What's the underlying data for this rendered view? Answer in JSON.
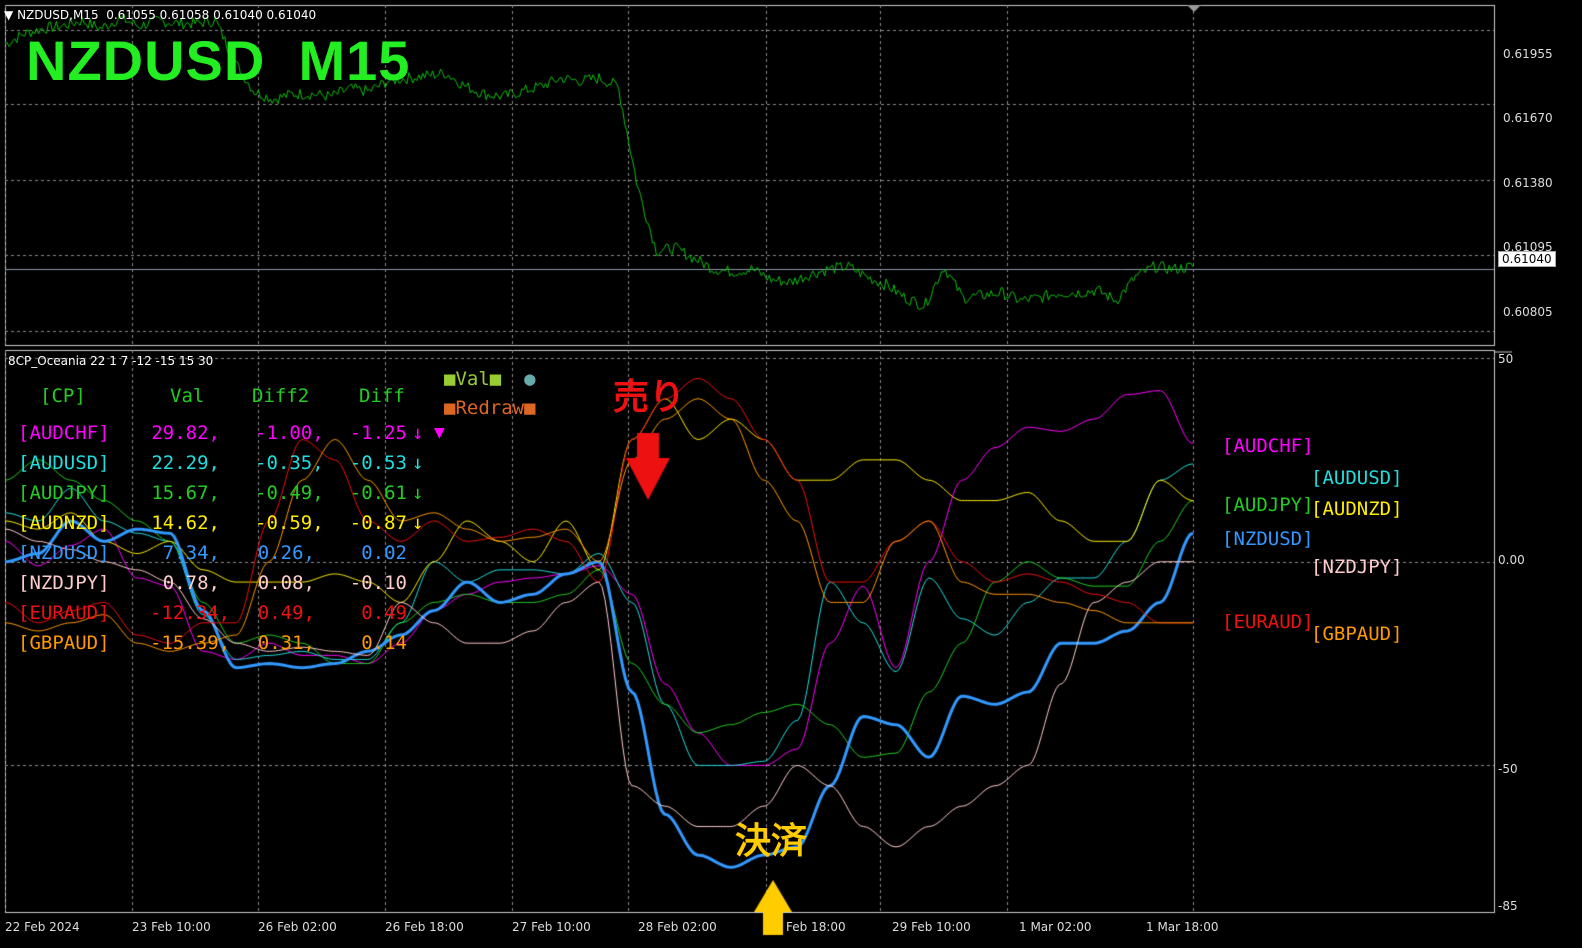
{
  "header": {
    "symbol_text": "NZDUSD,M15  0.61055 0.61058 0.61040 0.61040",
    "big_title": "NZDUSD  M15",
    "indicator_text": "8CP_Oceania 22 1 7 -12 -15 15 30"
  },
  "current_price_label": "0.61040",
  "price_axis": [
    "0.61955",
    "0.61670",
    "0.61380",
    "0.61095",
    "0.60805"
  ],
  "indicator_axis": [
    "50",
    "0.00",
    "-50",
    "-85"
  ],
  "time_axis": [
    "22 Feb 2024",
    "23 Feb 10:00",
    "26 Feb 02:00",
    "26 Feb 18:00",
    "27 Feb 10:00",
    "28 Feb 02:00",
    "Feb 18:00",
    "29 Feb 10:00",
    "1 Mar 02:00",
    "1 Mar 18:00"
  ],
  "legend": {
    "val": "Val",
    "redraw": "Redraw"
  },
  "table": {
    "headers": {
      "cp": "[CP]",
      "val": "Val",
      "diff2": "Diff2",
      "diff": "Diff"
    },
    "rows": [
      {
        "pair": "[AUDCHF]",
        "val": "29.82,",
        "diff2": "-1.00,",
        "diff": "-1.25",
        "arrow": "↓"
      },
      {
        "pair": "[AUDUSD]",
        "val": "22.29,",
        "diff2": "-0.35,",
        "diff": "-0.53",
        "arrow": "↓"
      },
      {
        "pair": "[AUDJPY]",
        "val": "15.67,",
        "diff2": "-0.49,",
        "diff": "-0.61",
        "arrow": "↓"
      },
      {
        "pair": "[AUDNZD]",
        "val": "14.62,",
        "diff2": "-0.59,",
        "diff": "-0.87",
        "arrow": "↓"
      },
      {
        "pair": "[NZDUSD]",
        "val": "7.34,",
        "diff2": "0.26,",
        "diff": "0.02",
        "arrow": ""
      },
      {
        "pair": "[NZDJPY]",
        "val": "0.78,",
        "diff2": "0.08,",
        "diff": "-0.10",
        "arrow": ""
      },
      {
        "pair": "[EURAUD]",
        "val": "-12.34,",
        "diff2": "0.49,",
        "diff": "0.49",
        "arrow": ""
      },
      {
        "pair": "[GBPAUD]",
        "val": "-15.39,",
        "diff2": "0.31,",
        "diff": "0.14",
        "arrow": ""
      }
    ]
  },
  "annotations": {
    "sell": "売り",
    "settle": "決済"
  },
  "colors": {
    "AUDCHF": "#ff00ff",
    "AUDUSD": "#22dddd",
    "AUDJPY": "#22cc22",
    "AUDNZD": "#ffee00",
    "NZDUSD": "#3399ff",
    "NZDJPY": "#ffcccc",
    "EURAUD": "#ee1111",
    "GBPAUD": "#ff9900",
    "price_line": "#11bb11",
    "sell_arrow": "#ee1111",
    "settle_arrow": "#ffcc00"
  },
  "chart_data": [
    {
      "type": "line",
      "series": [
        {
          "name": "NZDUSD",
          "values": [
            0.619,
            0.6194,
            0.6196,
            0.6197,
            0.6199,
            0.6196,
            0.62,
            0.6197,
            0.6199,
            0.6198,
            0.6198,
            0.6199,
            0.6183,
            0.6172,
            0.6169,
            0.6171,
            0.6171,
            0.617,
            0.6173,
            0.6172,
            0.6176,
            0.6177,
            0.6178,
            0.6179,
            0.6174,
            0.6171,
            0.617,
            0.6172,
            0.6174,
            0.6177,
            0.6176,
            0.6177,
            0.6174,
            0.6136,
            0.6111,
            0.6112,
            0.6108,
            0.6104,
            0.6103,
            0.6104,
            0.61,
            0.6099,
            0.6102,
            0.6104,
            0.6105,
            0.6101,
            0.6098,
            0.6093,
            0.609,
            0.6105,
            0.6093,
            0.6094,
            0.6095,
            0.6092,
            0.6093,
            0.6095,
            0.6095,
            0.6096,
            0.6092,
            0.6101,
            0.6105,
            0.6104,
            0.6105
          ]
        }
      ],
      "x_range": [
        "22 Feb 2024",
        "1 Mar 18:00"
      ],
      "ylim": [
        0.6075,
        0.6205
      ],
      "current_value": 0.6104,
      "grid": true
    },
    {
      "type": "line",
      "title": "8CP_Oceania 22 1 7 -12 -15 15 30",
      "ylim": [
        -85,
        50
      ],
      "reference_levels": [
        50,
        0,
        -50
      ],
      "series": [
        {
          "name": "[AUDCHF]",
          "color": "#ff00ff",
          "values": [
            5,
            -1,
            4,
            8,
            -4,
            -6,
            -22,
            -24,
            -20,
            -23,
            -23,
            -25,
            -20,
            -12,
            -8,
            -5,
            -4,
            -3,
            -1,
            -8,
            -30,
            -42,
            -50,
            -50,
            -46,
            -20,
            -6,
            -26,
            0,
            20,
            28,
            33,
            32,
            35,
            41,
            42,
            29
          ]
        },
        {
          "name": "[AUDUSD]",
          "color": "#22dddd",
          "values": [
            12,
            10,
            18,
            10,
            7,
            5,
            -13,
            -24,
            -23,
            -22,
            -24,
            -24,
            -15,
            0,
            -5,
            -2,
            -2,
            -3,
            2,
            -10,
            -35,
            -50,
            -50,
            -49,
            -39,
            -5,
            -15,
            -27,
            -4,
            -14,
            -18,
            -10,
            -4,
            -4,
            5,
            20,
            24
          ]
        },
        {
          "name": "[AUDJPY]",
          "color": "#22cc22",
          "values": [
            20,
            25,
            20,
            15,
            10,
            5,
            -10,
            -20,
            -18,
            -20,
            -25,
            -25,
            -15,
            -10,
            -8,
            -10,
            -10,
            -8,
            -2,
            -25,
            -35,
            -42,
            -40,
            -37,
            -35,
            -40,
            -48,
            -47,
            -32,
            -20,
            -5,
            0,
            -4,
            -6,
            -6,
            5,
            15
          ]
        },
        {
          "name": "[AUDNZD]",
          "color": "#ffee00",
          "values": [
            10,
            8,
            12,
            5,
            2,
            5,
            -2,
            -5,
            -5,
            -5,
            -3,
            -5,
            -10,
            0,
            10,
            5,
            0,
            10,
            -2,
            30,
            40,
            30,
            35,
            30,
            20,
            20,
            25,
            25,
            20,
            15,
            15,
            17,
            10,
            5,
            5,
            20,
            15
          ]
        },
        {
          "name": "[NZDUSD]",
          "color": "#3399ff",
          "values": [
            0,
            2,
            10,
            5,
            8,
            7,
            -12,
            -26,
            -25,
            -26,
            -25,
            -22,
            -18,
            -12,
            -5,
            -10,
            -8,
            -3,
            0,
            -32,
            -62,
            -72,
            -75,
            -72,
            -70,
            -55,
            -38,
            -40,
            -48,
            -33,
            -35,
            -32,
            -20,
            -20,
            -17,
            -10,
            7
          ]
        },
        {
          "name": "[NZDJPY]",
          "color": "#ffcccc",
          "values": [
            8,
            5,
            3,
            0,
            -2,
            -5,
            -14,
            -20,
            -22,
            -21,
            -22,
            -23,
            -10,
            -15,
            -20,
            -20,
            -17,
            -10,
            -5,
            -55,
            -60,
            -65,
            -65,
            -60,
            -50,
            -55,
            -65,
            -70,
            -65,
            -60,
            -55,
            -50,
            -30,
            -10,
            -5,
            0,
            0
          ]
        },
        {
          "name": "[EURAUD]",
          "color": "#ee1111",
          "values": [
            -10,
            -15,
            -12,
            -10,
            -18,
            -20,
            -15,
            -15,
            10,
            30,
            25,
            10,
            5,
            10,
            5,
            6,
            8,
            5,
            -5,
            30,
            40,
            45,
            40,
            30,
            20,
            -5,
            -5,
            5,
            10,
            0,
            -5,
            -3,
            -5,
            -8,
            -10,
            -15,
            -15
          ]
        },
        {
          "name": "[GBPAUD]",
          "color": "#ff9900",
          "values": [
            -15,
            -17,
            -15,
            -13,
            -20,
            -22,
            -20,
            -18,
            0,
            20,
            30,
            20,
            10,
            12,
            8,
            5,
            6,
            8,
            0,
            25,
            35,
            40,
            35,
            20,
            10,
            -10,
            -10,
            5,
            10,
            -5,
            -8,
            -8,
            -10,
            -12,
            -15,
            -15,
            -15
          ]
        }
      ]
    }
  ]
}
